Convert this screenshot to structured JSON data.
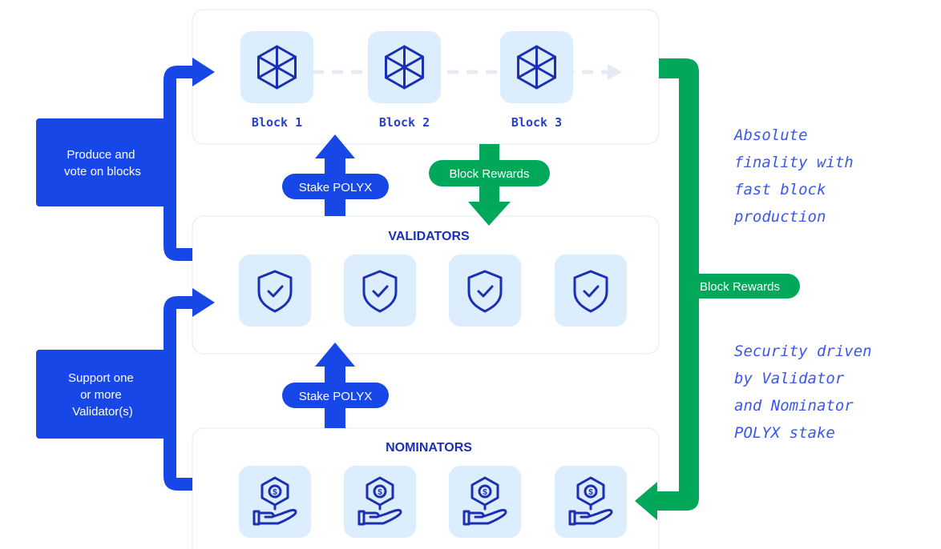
{
  "colors": {
    "blue": "#1747e6",
    "green": "#02a85a",
    "tile": "#dcedfd",
    "icon": "#1b2fb3",
    "note_text": "#3a57ef"
  },
  "blocks": [
    {
      "label": "Block 1",
      "icon": "cube-icon"
    },
    {
      "label": "Block 2",
      "icon": "cube-icon"
    },
    {
      "label": "Block 3",
      "icon": "cube-icon"
    }
  ],
  "validators": {
    "title": "VALIDATORS",
    "count": 4,
    "icon": "shield-check-icon"
  },
  "nominators": {
    "title": "NOMINATORS",
    "count": 4,
    "icon": "hand-coin-icon"
  },
  "arrows": {
    "stake_top": "Stake POLYX",
    "stake_bottom": "Stake POLYX",
    "rewards_blocks": "Block Rewards",
    "rewards_nominators": "Block Rewards"
  },
  "side_labels": {
    "validators_role": [
      "Produce and",
      "vote on blocks"
    ],
    "nominators_role": [
      "Support one",
      "or more",
      "Validator(s)"
    ]
  },
  "notes": {
    "finality": [
      "Absolute",
      "finality with",
      "fast block",
      "production"
    ],
    "security": [
      "Security driven",
      "by Validator",
      "and Nominator",
      "POLYX stake"
    ]
  }
}
